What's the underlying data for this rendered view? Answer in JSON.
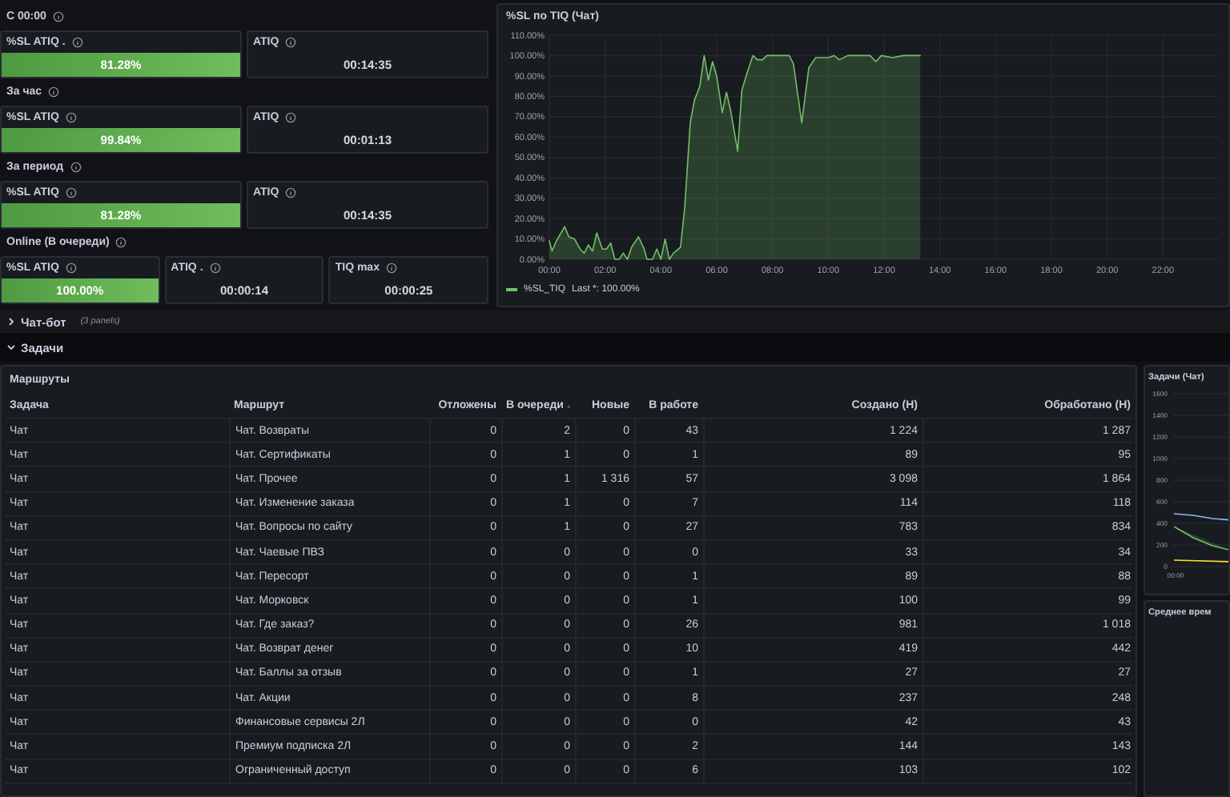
{
  "stat_groups": [
    {
      "title": "С 00:00",
      "stats": [
        {
          "label": "%SL ATIQ .",
          "value": "81.28%",
          "kind": "bar"
        },
        {
          "label": "ATIQ",
          "value": "00:14:35",
          "kind": "plain"
        }
      ]
    },
    {
      "title": "За час",
      "stats": [
        {
          "label": "%SL ATIQ",
          "value": "99.84%",
          "kind": "bar"
        },
        {
          "label": "ATIQ",
          "value": "00:01:13",
          "kind": "plain"
        }
      ]
    },
    {
      "title": "За период",
      "stats": [
        {
          "label": "%SL ATIQ",
          "value": "81.28%",
          "kind": "bar"
        },
        {
          "label": "ATIQ",
          "value": "00:14:35",
          "kind": "plain"
        }
      ]
    },
    {
      "title": "Online (В очереди)",
      "stats": [
        {
          "label": "%SL ATIQ",
          "value": "100.00%",
          "kind": "bar"
        },
        {
          "label": "ATIQ .",
          "value": "00:00:14",
          "kind": "plain"
        },
        {
          "label": "TIQ max",
          "value": "00:00:25",
          "kind": "plain"
        }
      ]
    }
  ],
  "chart_panel": {
    "title": "%SL по TIQ (Чат)",
    "legend_last": "Last *: 100.00%",
    "chart_data": {
      "type": "area",
      "grid": true,
      "xlim": [
        0,
        24
      ],
      "ylim": [
        0,
        110
      ],
      "xticks": [
        {
          "value": 0,
          "label": "00:00"
        },
        {
          "value": 2,
          "label": "02:00"
        },
        {
          "value": 4,
          "label": "04:00"
        },
        {
          "value": 6,
          "label": "06:00"
        },
        {
          "value": 8,
          "label": "08:00"
        },
        {
          "value": 10,
          "label": "10:00"
        },
        {
          "value": 12,
          "label": "12:00"
        },
        {
          "value": 14,
          "label": "14:00"
        },
        {
          "value": 16,
          "label": "16:00"
        },
        {
          "value": 18,
          "label": "18:00"
        },
        {
          "value": 20,
          "label": "20:00"
        },
        {
          "value": 22,
          "label": "22:00"
        }
      ],
      "yticks": [
        {
          "value": 0,
          "label": "0.00%"
        },
        {
          "value": 10,
          "label": "10.00%"
        },
        {
          "value": 20,
          "label": "20.00%"
        },
        {
          "value": 30,
          "label": "30.00%"
        },
        {
          "value": 40,
          "label": "40.00%"
        },
        {
          "value": 50,
          "label": "50.00%"
        },
        {
          "value": 60,
          "label": "60.00%"
        },
        {
          "value": 70,
          "label": "70.00%"
        },
        {
          "value": 80,
          "label": "80.00%"
        },
        {
          "value": 90,
          "label": "90.00%"
        },
        {
          "value": 100,
          "label": "100.00%"
        },
        {
          "value": 110,
          "label": "110.00%"
        }
      ],
      "x": [
        0,
        0.1,
        0.25,
        0.55,
        0.7,
        0.9,
        1.1,
        1.25,
        1.4,
        1.55,
        1.7,
        1.9,
        2.05,
        2.2,
        2.35,
        2.5,
        2.65,
        2.8,
        2.95,
        3.2,
        3.4,
        3.5,
        3.7,
        3.85,
        4.0,
        4.15,
        4.3,
        4.45,
        4.7,
        4.85,
        5.05,
        5.2,
        5.4,
        5.55,
        5.7,
        5.85,
        6.0,
        6.2,
        6.35,
        6.5,
        6.75,
        6.9,
        7.1,
        7.3,
        7.45,
        7.65,
        7.8,
        8.6,
        8.75,
        9.05,
        9.3,
        9.55,
        10.0,
        10.2,
        10.4,
        10.7,
        11.5,
        11.7,
        11.9,
        12.3,
        12.7,
        13.3
      ],
      "series": [
        {
          "name": "%SL_TIQ",
          "color": "#73bf69",
          "values": [
            9,
            4,
            9,
            16,
            11,
            10,
            5,
            3,
            7,
            4,
            13,
            5,
            5,
            8,
            0,
            0,
            3,
            0,
            6,
            11,
            5,
            0,
            0,
            5,
            0,
            10,
            0,
            3,
            6,
            25,
            67,
            78,
            85,
            100,
            88,
            97,
            90,
            72,
            82,
            73,
            53,
            83,
            92,
            100,
            98,
            98,
            100,
            100,
            96,
            67,
            94,
            99,
            99,
            100,
            98,
            100,
            100,
            97,
            100,
            99,
            100,
            100
          ]
        }
      ]
    }
  },
  "sections": [
    {
      "title": "Чат-бот",
      "note": "(3 panels)",
      "expanded": false
    },
    {
      "title": "Задачи",
      "expanded": true
    }
  ],
  "table_panel": {
    "title": "Маршруты",
    "columns": [
      {
        "label": "Задача",
        "kind": "text",
        "sorted": false
      },
      {
        "label": "Маршрут",
        "kind": "text",
        "sorted": false
      },
      {
        "label": "Отложены",
        "kind": "number",
        "sorted": false
      },
      {
        "label": "В очереди",
        "kind": "number",
        "sorted": true
      },
      {
        "label": "Новые",
        "kind": "number",
        "sorted": false
      },
      {
        "label": "В работе",
        "kind": "number",
        "sorted": false
      },
      {
        "label": "Создано (Н)",
        "kind": "number",
        "sorted": false
      },
      {
        "label": "Обработано (Н)",
        "kind": "number",
        "sorted": false
      }
    ],
    "rows": [
      [
        "Чат",
        "Чат. Возвраты",
        "0",
        "2",
        "0",
        "43",
        "1 224",
        "1 287"
      ],
      [
        "Чат",
        "Чат. Сертификаты",
        "0",
        "1",
        "0",
        "1",
        "89",
        "95"
      ],
      [
        "Чат",
        "Чат. Прочее",
        "0",
        "1",
        "1 316",
        "57",
        "3 098",
        "1 864"
      ],
      [
        "Чат",
        "Чат. Изменение заказа",
        "0",
        "1",
        "0",
        "7",
        "114",
        "118"
      ],
      [
        "Чат",
        "Чат. Вопросы по сайту",
        "0",
        "1",
        "0",
        "27",
        "783",
        "834"
      ],
      [
        "Чат",
        "Чат. Чаевые ПВЗ",
        "0",
        "0",
        "0",
        "0",
        "33",
        "34"
      ],
      [
        "Чат",
        "Чат. Пересорт",
        "0",
        "0",
        "0",
        "1",
        "89",
        "88"
      ],
      [
        "Чат",
        "Чат. Морковск",
        "0",
        "0",
        "0",
        "1",
        "100",
        "99"
      ],
      [
        "Чат",
        "Чат. Где заказ?",
        "0",
        "0",
        "0",
        "26",
        "981",
        "1 018"
      ],
      [
        "Чат",
        "Чат. Возврат денег",
        "0",
        "0",
        "0",
        "10",
        "419",
        "442"
      ],
      [
        "Чат",
        "Чат. Баллы за отзыв",
        "0",
        "0",
        "0",
        "1",
        "27",
        "27"
      ],
      [
        "Чат",
        "Чат. Акции",
        "0",
        "0",
        "0",
        "8",
        "237",
        "248"
      ],
      [
        "Чат",
        "Финансовые сервисы 2Л",
        "0",
        "0",
        "0",
        "0",
        "42",
        "43"
      ],
      [
        "Чат",
        "Премиум подписка 2Л",
        "0",
        "0",
        "0",
        "2",
        "144",
        "143"
      ],
      [
        "Чат",
        "Ограниченный доступ",
        "0",
        "0",
        "0",
        "6",
        "103",
        "102"
      ]
    ]
  },
  "side_panels": [
    {
      "title": "Задачи (Чат)",
      "y_axis_labels": [
        "1600",
        "1400",
        "1200",
        "1000",
        "800",
        "600",
        "400",
        "200",
        "0"
      ],
      "x_axis_label": "00:00"
    },
    {
      "title": "Среднее врем"
    }
  ]
}
